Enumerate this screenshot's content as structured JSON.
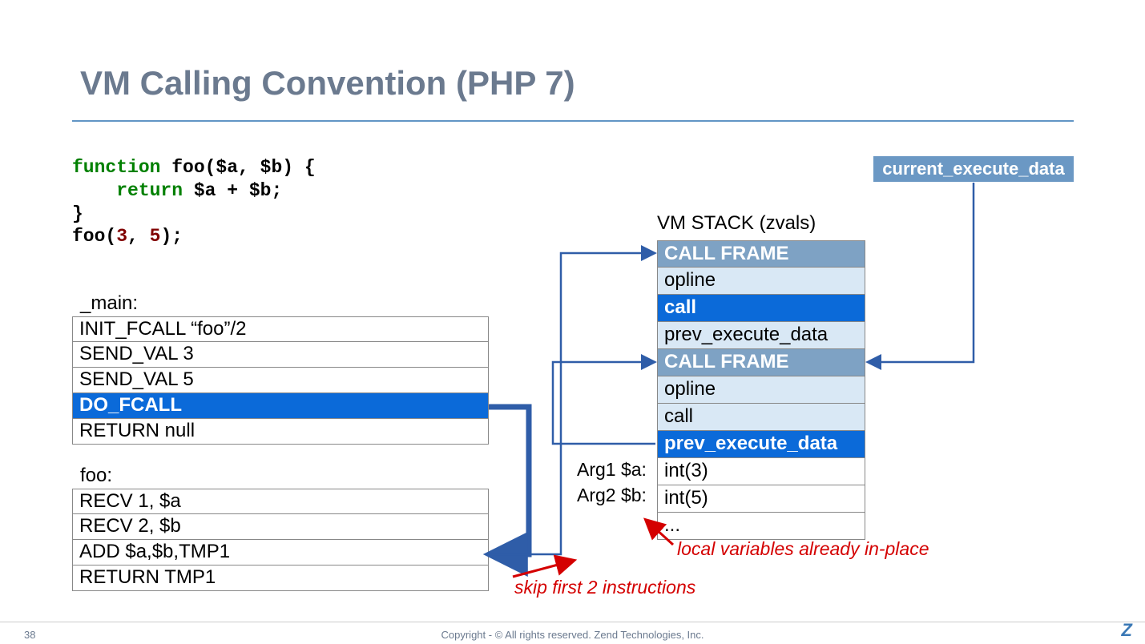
{
  "title": "VM Calling Convention (PHP 7)",
  "code": {
    "l1a": "function",
    "l1b": " foo($a, $b) {",
    "l2a": "    return",
    "l2b": " $a + $b;",
    "l3": "}",
    "l4a": "foo(",
    "l4b": "3",
    "l4c": ", ",
    "l4d": "5",
    "l4e": ");"
  },
  "labels": {
    "main": "_main:",
    "foo": "foo:"
  },
  "opcodes_main": [
    "INIT_FCALL  “foo”/2",
    "SEND_VAL 3",
    "SEND_VAL 5",
    "DO_FCALL",
    "RETURN null"
  ],
  "opcodes_foo": [
    "RECV 1, $a",
    "RECV 2, $b",
    "ADD $a,$b,TMP1",
    "RETURN TMP1"
  ],
  "stack_title": "VM STACK (zvals)",
  "stack": [
    {
      "text": "CALL FRAME",
      "cls": "sr-frame"
    },
    {
      "text": "opline",
      "cls": "sr-light"
    },
    {
      "text": "call",
      "cls": "sr-blue"
    },
    {
      "text": "prev_execute_data",
      "cls": "sr-light"
    },
    {
      "text": "CALL FRAME",
      "cls": "sr-frame"
    },
    {
      "text": "opline",
      "cls": "sr-light"
    },
    {
      "text": "call",
      "cls": "sr-light"
    },
    {
      "text": "prev_execute_data",
      "cls": "sr-blue"
    },
    {
      "text": "int(3)",
      "cls": "sr-white"
    },
    {
      "text": "int(5)",
      "cls": "sr-white"
    },
    {
      "text": "...",
      "cls": "sr-white"
    }
  ],
  "arg_labels": {
    "a1": "Arg1 $a:",
    "a2": "Arg2 $b:"
  },
  "callouts": {
    "c1": "local variables already in-place",
    "c2": "skip first 2 instructions"
  },
  "ced": "current_execute_data",
  "footer": {
    "slide": "38",
    "copyright": "Copyright - © All rights reserved. Zend Technologies, Inc.",
    "logo": "Z"
  }
}
